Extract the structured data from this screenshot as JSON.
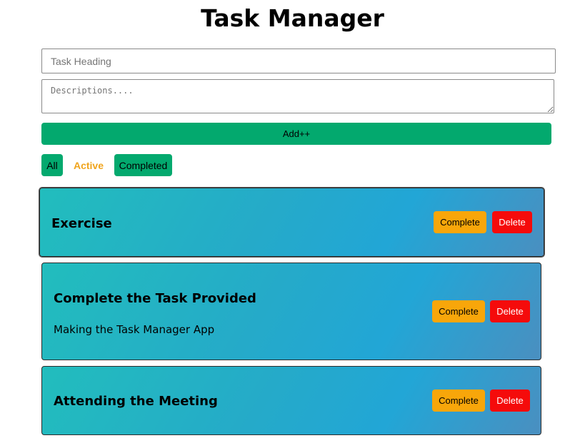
{
  "header": {
    "title": "Task Manager"
  },
  "form": {
    "heading_placeholder": "Task Heading",
    "heading_value": "",
    "description_placeholder": "Descriptions....",
    "description_value": "",
    "add_label": "Add++"
  },
  "filters": {
    "all_label": "All",
    "active_label": "Active",
    "completed_label": "Completed",
    "selected": "Active"
  },
  "tasks": [
    {
      "title": "Exercise",
      "description": "",
      "complete_label": "Complete",
      "delete_label": "Delete"
    },
    {
      "title": "Complete the Task Provided",
      "description": "Making the Task Manager App",
      "complete_label": "Complete",
      "delete_label": "Delete"
    },
    {
      "title": "Attending the Meeting",
      "description": "",
      "complete_label": "Complete",
      "delete_label": "Delete"
    }
  ],
  "colors": {
    "accent_green": "#03a96e",
    "active_filter_text": "#f0a41c",
    "complete_button": "#f8a60a",
    "delete_button": "#f50b0b",
    "card_gradient_start": "#22bdbd",
    "card_gradient_end": "#4a8fc0"
  }
}
